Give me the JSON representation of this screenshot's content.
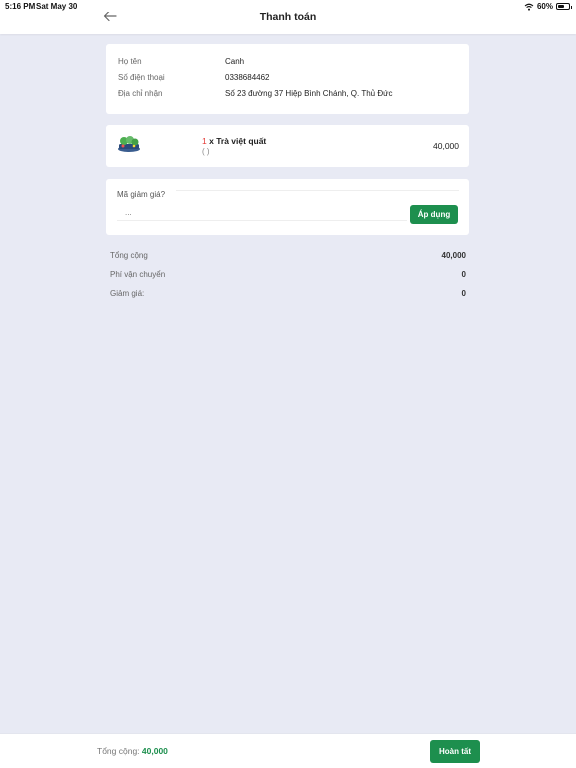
{
  "status_bar": {
    "time": "5:16 PM",
    "date": "Sat May 30",
    "battery": "60%",
    "battery_level": 0.6,
    "icons": [
      "wifi-icon",
      "battery-icon"
    ]
  },
  "header": {
    "title": "Thanh toán",
    "back_icon": "arrow-left-icon"
  },
  "customer": {
    "name_label": "Họ tên",
    "name_value": "Canh",
    "phone_label": "Số điện thoại",
    "phone_value": "0338684462",
    "address_label": "Địa chỉ nhận",
    "address_value": "Số 23 đường 37 Hiệp Bình Chánh, Q. Thủ Đức"
  },
  "cart": {
    "items": [
      {
        "quantity": "1",
        "separator": " x ",
        "name": "Trà việt quất",
        "options": "( )",
        "price": "40,000",
        "image": "product-thumbnail"
      }
    ]
  },
  "discount": {
    "label": "Mã giảm giá?",
    "placeholder": "...",
    "apply_label": "Áp dụng"
  },
  "summary": {
    "subtotal_label": "Tổng cộng",
    "subtotal_value": "40,000",
    "shipping_label": "Phí vận chuyển",
    "shipping_value": "0",
    "discount_label": "Giảm giá:",
    "discount_value": "0"
  },
  "footer": {
    "total_label": "Tổng cộng:",
    "total_value": "40,000",
    "complete_label": "Hoàn tất"
  },
  "colors": {
    "accent": "#1d8f4e",
    "background": "#e8eaf4",
    "quantity": "#e53935"
  }
}
